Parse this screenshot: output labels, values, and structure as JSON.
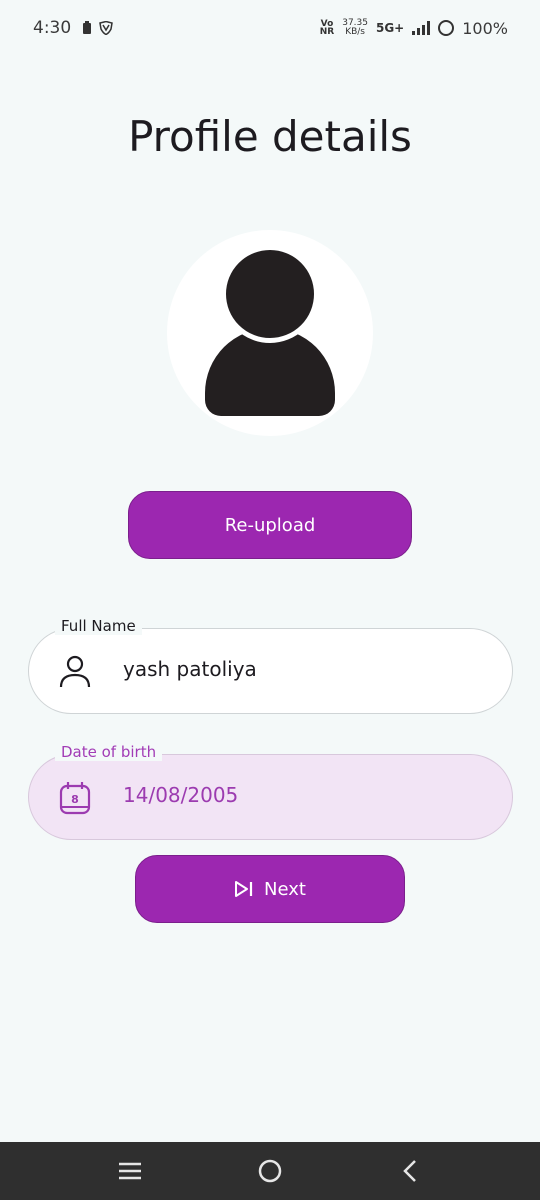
{
  "status_bar": {
    "time": "4:30",
    "volte_top": "Vo",
    "volte_bottom": "NR",
    "speed_value": "37.35",
    "speed_unit": "KB/s",
    "network": "5G+",
    "battery": "100%"
  },
  "page": {
    "title": "Profile details"
  },
  "avatar": {
    "icon": "person-avatar-icon"
  },
  "reupload_button": {
    "label": "Re-upload"
  },
  "full_name_field": {
    "label": "Full Name",
    "value": "yash patoliya",
    "icon": "person-icon"
  },
  "dob_field": {
    "label": "Date of birth",
    "value": "14/08/2005",
    "icon": "calendar-icon",
    "icon_day": "8"
  },
  "next_button": {
    "label": "Next",
    "icon": "skip-next-icon"
  },
  "colors": {
    "accent": "#9c27b0",
    "background": "#f4f9f9",
    "dob_fill": "#f2e4f5",
    "nav_bar": "#2f2f2f"
  }
}
